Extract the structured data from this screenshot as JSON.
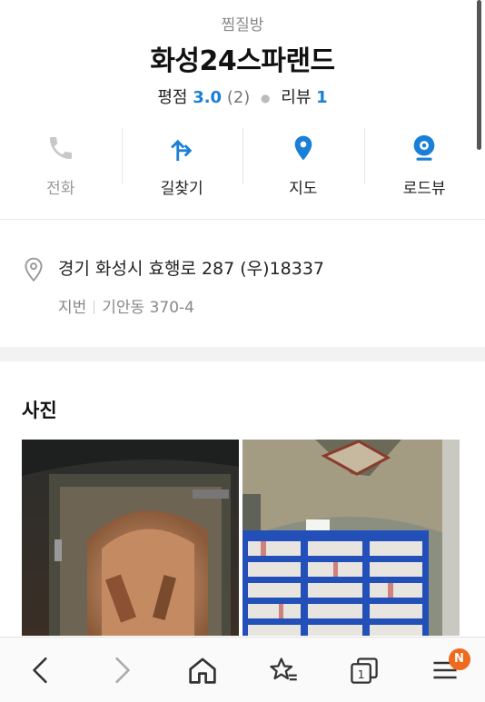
{
  "place": {
    "category": "찜질방",
    "name": "화성24스파랜드",
    "rating_label": "평점",
    "rating_value": "3.0",
    "rating_count": "(2)",
    "review_label": "리뷰",
    "review_count": "1"
  },
  "actions": [
    {
      "label": "전화",
      "icon": "phone-icon",
      "enabled": false
    },
    {
      "label": "길찾기",
      "icon": "directions-icon",
      "enabled": true
    },
    {
      "label": "지도",
      "icon": "map-pin-icon",
      "enabled": true
    },
    {
      "label": "로드뷰",
      "icon": "roadview-icon",
      "enabled": true
    }
  ],
  "address": {
    "road": "경기 화성시 효행로 287 (우)18337",
    "lot_label": "지번",
    "lot": "기안동 370-4"
  },
  "photos": {
    "title": "사진"
  },
  "bottom_nav": {
    "tab_count": "1",
    "badge": "N"
  },
  "colors": {
    "accent": "#1a7fd6",
    "badge": "#ee6a1e"
  }
}
